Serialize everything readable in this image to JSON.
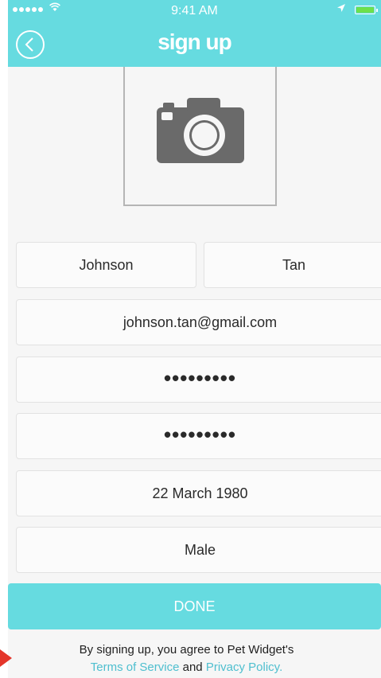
{
  "status_bar": {
    "time": "9:41 AM"
  },
  "header": {
    "title": "sign up",
    "back_icon": "chevron-left-icon"
  },
  "photo": {
    "icon": "camera-icon"
  },
  "form": {
    "first_name": "Johnson",
    "last_name": "Tan",
    "email": "johnson.tan@gmail.com",
    "password": "•••••••••",
    "confirm_password": "•••••••••",
    "birthday": "22 March 1980",
    "gender": "Male"
  },
  "done_button": "DONE",
  "terms": {
    "line1": "By signing up, you agree to Pet Widget's",
    "terms_link": "Terms of Service",
    "and": "and",
    "privacy_link": "Privacy Policy."
  },
  "colors": {
    "accent": "#66dbe0",
    "link": "#4fbfcf",
    "indicator": "#e4352a"
  }
}
